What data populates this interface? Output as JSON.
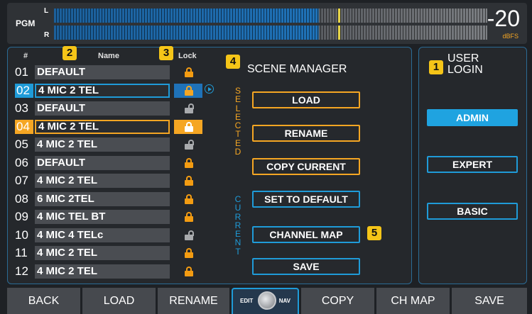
{
  "meter": {
    "label": "PGM",
    "ch_left": "L",
    "ch_right": "R",
    "value": "-20",
    "unit": "dBFS",
    "level_fraction": 0.61
  },
  "list": {
    "col_num": "#",
    "col_name": "Name",
    "col_lock": "Lock",
    "rows": [
      {
        "num": "01",
        "name": "DEFAULT",
        "locked": true
      },
      {
        "num": "02",
        "name": "4 MIC  2 TEL",
        "locked": true
      },
      {
        "num": "03",
        "name": "DEFAULT",
        "locked": false
      },
      {
        "num": "04",
        "name": "4 MIC  2 TEL",
        "locked": true
      },
      {
        "num": "05",
        "name": "4 MIC  2 TEL",
        "locked": false
      },
      {
        "num": "06",
        "name": "DEFAULT",
        "locked": true
      },
      {
        "num": "07",
        "name": "4 MIC  2 TEL",
        "locked": true
      },
      {
        "num": "08",
        "name": "6 MIC  2TEL",
        "locked": true
      },
      {
        "num": "09",
        "name": "4 MIC TEL BT",
        "locked": true
      },
      {
        "num": "10",
        "name": "4 MIC 4 TELc",
        "locked": false
      },
      {
        "num": "11",
        "name": "4 MIC  2 TEL",
        "locked": true
      },
      {
        "num": "12",
        "name": "4 MIC  2 TEL",
        "locked": true
      }
    ]
  },
  "badges": {
    "b1": "1",
    "b2": "2",
    "b3": "3",
    "b4": "4",
    "b5": "5"
  },
  "scene_manager": {
    "title": "SCENE MANAGER",
    "selected_label": "SELECTED",
    "current_label": "CURRENT",
    "buttons": {
      "load": "LOAD",
      "rename": "RENAME",
      "copy_current": "COPY CURRENT",
      "set_default": "SET TO DEFAULT",
      "channel_map": "CHANNEL MAP",
      "save": "SAVE"
    }
  },
  "login": {
    "title_line1": "USER",
    "title_line2": "LOGIN",
    "admin": "ADMIN",
    "expert": "EXPERT",
    "basic": "BASIC"
  },
  "footer": {
    "back": "BACK",
    "load": "LOAD",
    "rename": "RENAME",
    "edit": "EDIT",
    "nav": "NAV",
    "copy": "COPY",
    "ch_map": "CH MAP",
    "save": "SAVE"
  },
  "colors": {
    "accent_blue": "#1f9bd8",
    "accent_orange": "#f5a623",
    "badge_yellow": "#f5c518"
  }
}
